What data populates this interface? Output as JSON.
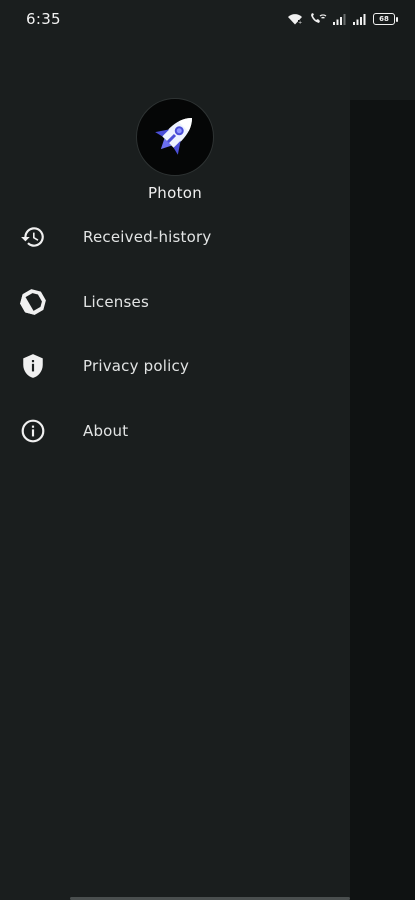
{
  "status_bar": {
    "time": "6:35",
    "battery_level": "68",
    "icons": [
      "wifi-icon",
      "vowifi-icon",
      "signal-icon",
      "signal-icon",
      "battery-icon"
    ]
  },
  "drawer": {
    "app_name": "Photon",
    "avatar_icon": "rocket-icon",
    "items": [
      {
        "label": "Received-history",
        "icon": "history-icon"
      },
      {
        "label": "Licenses",
        "icon": "license-badge-icon"
      },
      {
        "label": "Privacy policy",
        "icon": "shield-icon"
      },
      {
        "label": "About",
        "icon": "info-icon"
      }
    ]
  },
  "colors": {
    "drawer_background": "#1a1e1e",
    "screen_background": "#131717",
    "text": "#e2e4e4",
    "rocket_accent": "#4b4fd8"
  }
}
